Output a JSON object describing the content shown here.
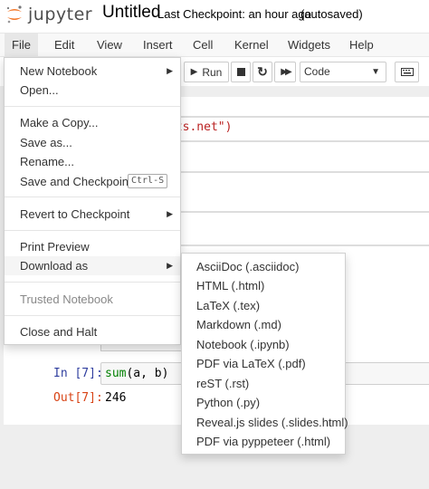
{
  "header": {
    "logo_text": "jupyter",
    "notebook_title": "Untitled",
    "checkpoint": "Last Checkpoint: an hour ago",
    "autosave": "(autosaved)",
    "logo_color": "#f37626"
  },
  "menubar": {
    "items": [
      "File",
      "Edit",
      "View",
      "Insert",
      "Cell",
      "Kernel",
      "Widgets",
      "Help"
    ],
    "open_item": "File"
  },
  "toolbar": {
    "run_label": "Run",
    "cell_type": "Code"
  },
  "file_menu": {
    "new_notebook": "New Notebook",
    "open": "Open...",
    "make_copy": "Make a Copy...",
    "save_as": "Save as...",
    "rename": "Rename...",
    "save_checkpoint": "Save and Checkpoint",
    "save_checkpoint_shortcut": "Ctrl-S",
    "revert": "Revert to Checkpoint",
    "print_preview": "Print Preview",
    "download_as": "Download as",
    "trusted": "Trusted Notebook",
    "close_halt": "Close and Halt"
  },
  "download_menu": {
    "items": [
      "AsciiDoc (.asciidoc)",
      "HTML (.html)",
      "LaTeX (.tex)",
      "Markdown (.md)",
      "Notebook (.ipynb)",
      "PDF via LaTeX (.pdf)",
      "reST (.rst)",
      "Python (.py)",
      "Reveal.js slides (.slides.html)",
      "PDF via pyppeteer (.html)"
    ]
  },
  "cells": {
    "partial_code": "uts.net\")",
    "in_prompt": "In [7]:",
    "in_code_fn": "sum",
    "in_code_args": "(a, b)",
    "out_prompt": "Out[7]:",
    "out_value": "246"
  }
}
